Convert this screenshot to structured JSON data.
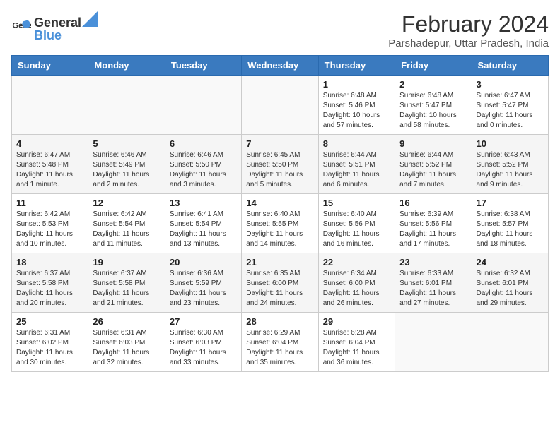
{
  "header": {
    "logo_general": "General",
    "logo_blue": "Blue",
    "title": "February 2024",
    "subtitle": "Parshadepur, Uttar Pradesh, India"
  },
  "days_of_week": [
    "Sunday",
    "Monday",
    "Tuesday",
    "Wednesday",
    "Thursday",
    "Friday",
    "Saturday"
  ],
  "weeks": [
    [
      {
        "day": "",
        "info": ""
      },
      {
        "day": "",
        "info": ""
      },
      {
        "day": "",
        "info": ""
      },
      {
        "day": "",
        "info": ""
      },
      {
        "day": "1",
        "info": "Sunrise: 6:48 AM\nSunset: 5:46 PM\nDaylight: 10 hours and 57 minutes."
      },
      {
        "day": "2",
        "info": "Sunrise: 6:48 AM\nSunset: 5:47 PM\nDaylight: 10 hours and 58 minutes."
      },
      {
        "day": "3",
        "info": "Sunrise: 6:47 AM\nSunset: 5:47 PM\nDaylight: 11 hours and 0 minutes."
      }
    ],
    [
      {
        "day": "4",
        "info": "Sunrise: 6:47 AM\nSunset: 5:48 PM\nDaylight: 11 hours and 1 minute."
      },
      {
        "day": "5",
        "info": "Sunrise: 6:46 AM\nSunset: 5:49 PM\nDaylight: 11 hours and 2 minutes."
      },
      {
        "day": "6",
        "info": "Sunrise: 6:46 AM\nSunset: 5:50 PM\nDaylight: 11 hours and 3 minutes."
      },
      {
        "day": "7",
        "info": "Sunrise: 6:45 AM\nSunset: 5:50 PM\nDaylight: 11 hours and 5 minutes."
      },
      {
        "day": "8",
        "info": "Sunrise: 6:44 AM\nSunset: 5:51 PM\nDaylight: 11 hours and 6 minutes."
      },
      {
        "day": "9",
        "info": "Sunrise: 6:44 AM\nSunset: 5:52 PM\nDaylight: 11 hours and 7 minutes."
      },
      {
        "day": "10",
        "info": "Sunrise: 6:43 AM\nSunset: 5:52 PM\nDaylight: 11 hours and 9 minutes."
      }
    ],
    [
      {
        "day": "11",
        "info": "Sunrise: 6:42 AM\nSunset: 5:53 PM\nDaylight: 11 hours and 10 minutes."
      },
      {
        "day": "12",
        "info": "Sunrise: 6:42 AM\nSunset: 5:54 PM\nDaylight: 11 hours and 11 minutes."
      },
      {
        "day": "13",
        "info": "Sunrise: 6:41 AM\nSunset: 5:54 PM\nDaylight: 11 hours and 13 minutes."
      },
      {
        "day": "14",
        "info": "Sunrise: 6:40 AM\nSunset: 5:55 PM\nDaylight: 11 hours and 14 minutes."
      },
      {
        "day": "15",
        "info": "Sunrise: 6:40 AM\nSunset: 5:56 PM\nDaylight: 11 hours and 16 minutes."
      },
      {
        "day": "16",
        "info": "Sunrise: 6:39 AM\nSunset: 5:56 PM\nDaylight: 11 hours and 17 minutes."
      },
      {
        "day": "17",
        "info": "Sunrise: 6:38 AM\nSunset: 5:57 PM\nDaylight: 11 hours and 18 minutes."
      }
    ],
    [
      {
        "day": "18",
        "info": "Sunrise: 6:37 AM\nSunset: 5:58 PM\nDaylight: 11 hours and 20 minutes."
      },
      {
        "day": "19",
        "info": "Sunrise: 6:37 AM\nSunset: 5:58 PM\nDaylight: 11 hours and 21 minutes."
      },
      {
        "day": "20",
        "info": "Sunrise: 6:36 AM\nSunset: 5:59 PM\nDaylight: 11 hours and 23 minutes."
      },
      {
        "day": "21",
        "info": "Sunrise: 6:35 AM\nSunset: 6:00 PM\nDaylight: 11 hours and 24 minutes."
      },
      {
        "day": "22",
        "info": "Sunrise: 6:34 AM\nSunset: 6:00 PM\nDaylight: 11 hours and 26 minutes."
      },
      {
        "day": "23",
        "info": "Sunrise: 6:33 AM\nSunset: 6:01 PM\nDaylight: 11 hours and 27 minutes."
      },
      {
        "day": "24",
        "info": "Sunrise: 6:32 AM\nSunset: 6:01 PM\nDaylight: 11 hours and 29 minutes."
      }
    ],
    [
      {
        "day": "25",
        "info": "Sunrise: 6:31 AM\nSunset: 6:02 PM\nDaylight: 11 hours and 30 minutes."
      },
      {
        "day": "26",
        "info": "Sunrise: 6:31 AM\nSunset: 6:03 PM\nDaylight: 11 hours and 32 minutes."
      },
      {
        "day": "27",
        "info": "Sunrise: 6:30 AM\nSunset: 6:03 PM\nDaylight: 11 hours and 33 minutes."
      },
      {
        "day": "28",
        "info": "Sunrise: 6:29 AM\nSunset: 6:04 PM\nDaylight: 11 hours and 35 minutes."
      },
      {
        "day": "29",
        "info": "Sunrise: 6:28 AM\nSunset: 6:04 PM\nDaylight: 11 hours and 36 minutes."
      },
      {
        "day": "",
        "info": ""
      },
      {
        "day": "",
        "info": ""
      }
    ]
  ]
}
